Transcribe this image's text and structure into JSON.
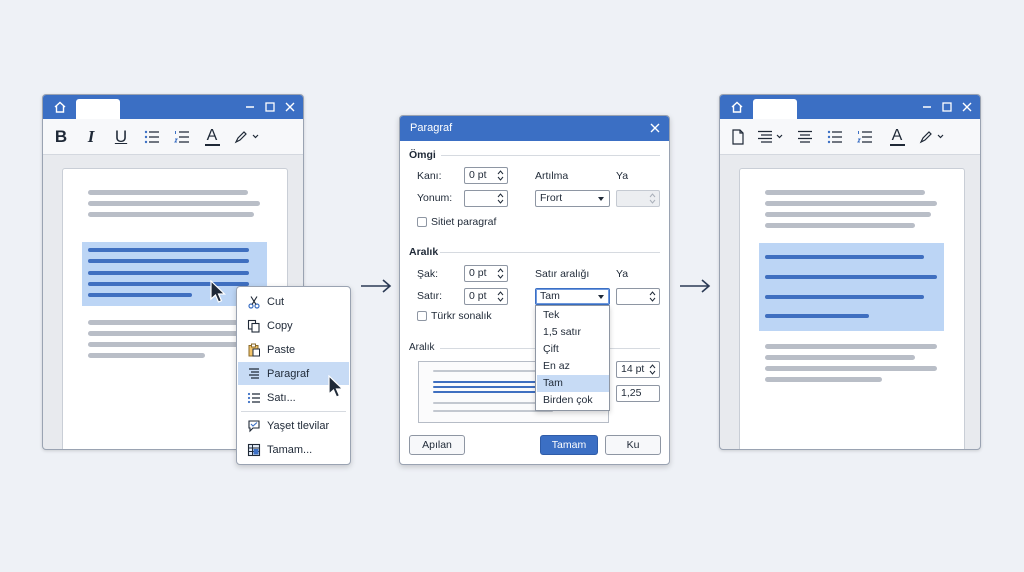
{
  "colors": {
    "titlebar": "#3b6fc4",
    "selection": "#bcd5f5",
    "menu_selected": "#c7dbf5",
    "primary_button": "#3b6fc4",
    "body_line_blue": "#3f6fc0"
  },
  "left_window": {
    "toolbar": {
      "bold": "B",
      "italic": "I",
      "underline": "U",
      "font_color": "A"
    }
  },
  "context_menu": {
    "items": [
      {
        "label": "Cut",
        "icon": "scissors-icon"
      },
      {
        "label": "Copy",
        "icon": "copy-icon"
      },
      {
        "label": "Paste",
        "icon": "clipboard-icon"
      },
      {
        "label": "Paragraf",
        "icon": "paragraph-icon",
        "selected": true
      },
      {
        "label": "Satı...",
        "icon": "list-icon"
      },
      {
        "label": "Yaşet tlevilar",
        "icon": "comment-icon"
      },
      {
        "label": "Tamam...",
        "icon": "table-icon"
      }
    ]
  },
  "dialog": {
    "title": "Paragraf",
    "section1": {
      "heading": "Ömgi",
      "left_label": "Kanı:",
      "left_value": "0 pt",
      "right_label": "Yonum:",
      "right_value": "",
      "artilma_label": "Artılma",
      "artilma_value": "Frort",
      "ya_label": "Ya",
      "checkbox_label": "Sitiet paragraf"
    },
    "section2": {
      "heading": "Aralık",
      "sak_label": "Şak:",
      "sak_value": "0 pt",
      "satir_label": "Satır:",
      "satir_value": "0 pt",
      "satir_araligi_label": "Satır aralığı",
      "satir_araligi_value": "Tam",
      "ya_label": "Ya",
      "checkbox_label": "Türkr sonalık"
    },
    "section3": {
      "heading": "Aralık",
      "pt_value": "14 pt",
      "ratio_value": "1,25"
    },
    "dropdown_options": [
      {
        "label": "Tek"
      },
      {
        "label": "1,5 satır"
      },
      {
        "label": "Çift"
      },
      {
        "label": "En az"
      },
      {
        "label": "Tam",
        "selected": true
      },
      {
        "label": "Birden çok"
      }
    ],
    "buttons": {
      "apply": "Apılan",
      "ok": "Tamam",
      "cancel": "Ku"
    }
  },
  "right_window": {
    "toolbar": {
      "font_color": "A"
    }
  }
}
